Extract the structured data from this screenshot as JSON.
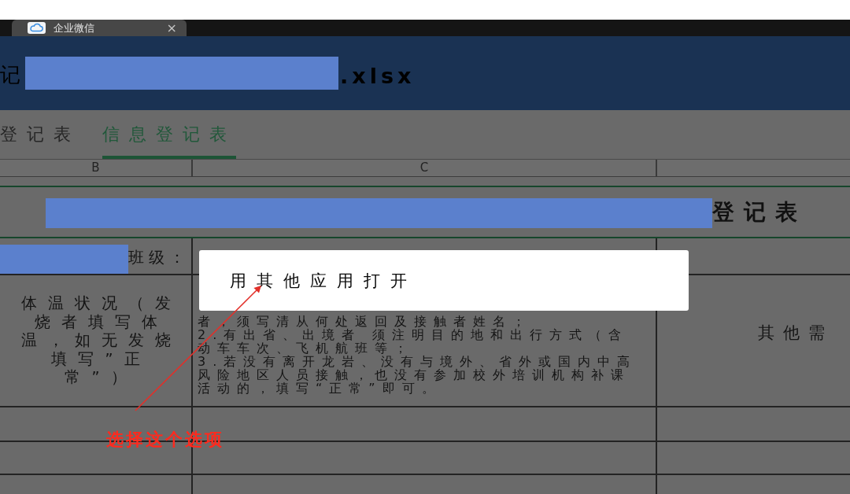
{
  "window_tab": {
    "title": "企业微信",
    "close_glyph": "×"
  },
  "file_header": {
    "title_start": "记",
    "title_end": ".xlsx"
  },
  "sheet_tabs": [
    {
      "label": "登记表",
      "selected": false
    },
    {
      "label": "信息登记表",
      "selected": true
    }
  ],
  "column_headers": [
    "B",
    "C"
  ],
  "sheet": {
    "title_end": "登记表",
    "class_label": "班级：",
    "temperature_header": "体温状况（发烧者填写体温，如无发烧填写”正常”）",
    "instructions": [
      "者，须写清从何处返回及接触者姓名；",
      "2.有出省、出境者 须注明目的地和出行方式（含动车车次、飞机航班等；",
      "3.若没有离开龙岩、没有与境外、省外或国内中高风险地区人员接触，也没有参加校外培训机构补课活动的，填写“正常”即可。"
    ],
    "column_3": "其他需"
  },
  "context_menu": {
    "items": [
      {
        "label": "用其他应用打开"
      }
    ]
  },
  "annotation": {
    "label": "选择这个选项"
  }
}
